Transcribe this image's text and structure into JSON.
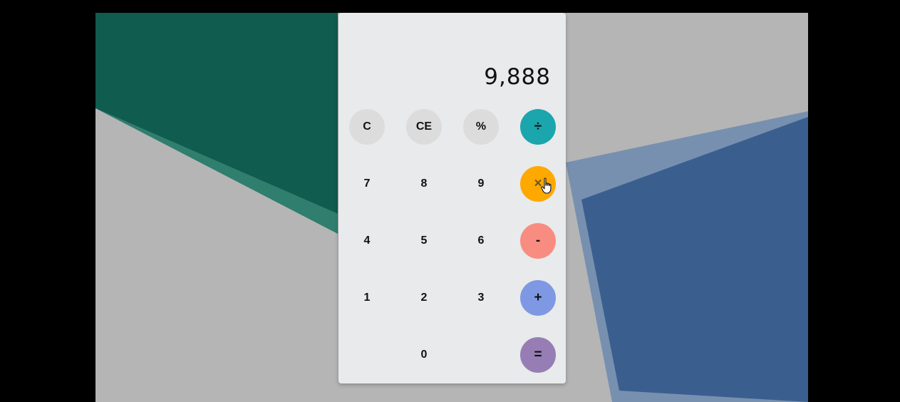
{
  "calculator": {
    "display": "9,888",
    "keys": [
      {
        "label": "C",
        "kind": "function",
        "color": "#dcdcdc"
      },
      {
        "label": "CE",
        "kind": "function",
        "color": "#dcdcdc"
      },
      {
        "label": "%",
        "kind": "function",
        "color": "#dcdcdc"
      },
      {
        "label": "÷",
        "kind": "operator",
        "color": "#1ba5ac"
      },
      {
        "label": "7",
        "kind": "digit"
      },
      {
        "label": "8",
        "kind": "digit"
      },
      {
        "label": "9",
        "kind": "digit"
      },
      {
        "label": "×",
        "kind": "operator",
        "color": "#ffa800"
      },
      {
        "label": "4",
        "kind": "digit"
      },
      {
        "label": "5",
        "kind": "digit"
      },
      {
        "label": "6",
        "kind": "digit"
      },
      {
        "label": "-",
        "kind": "operator",
        "color": "#f98c80"
      },
      {
        "label": "1",
        "kind": "digit"
      },
      {
        "label": "2",
        "kind": "digit"
      },
      {
        "label": "3",
        "kind": "digit"
      },
      {
        "label": "+",
        "kind": "operator",
        "color": "#7e98e3"
      },
      {
        "label": "0",
        "kind": "digit"
      },
      {
        "label": "=",
        "kind": "operator",
        "color": "#967eb5"
      }
    ]
  },
  "background": {
    "colors": {
      "base": "#b5b5b5",
      "green": "#105c4f",
      "teal": "#2f7e6e",
      "blue": "#3a5f8f",
      "light_blue": "#7790b0"
    }
  },
  "cursor": {
    "icon": "hand-pointer-icon"
  }
}
